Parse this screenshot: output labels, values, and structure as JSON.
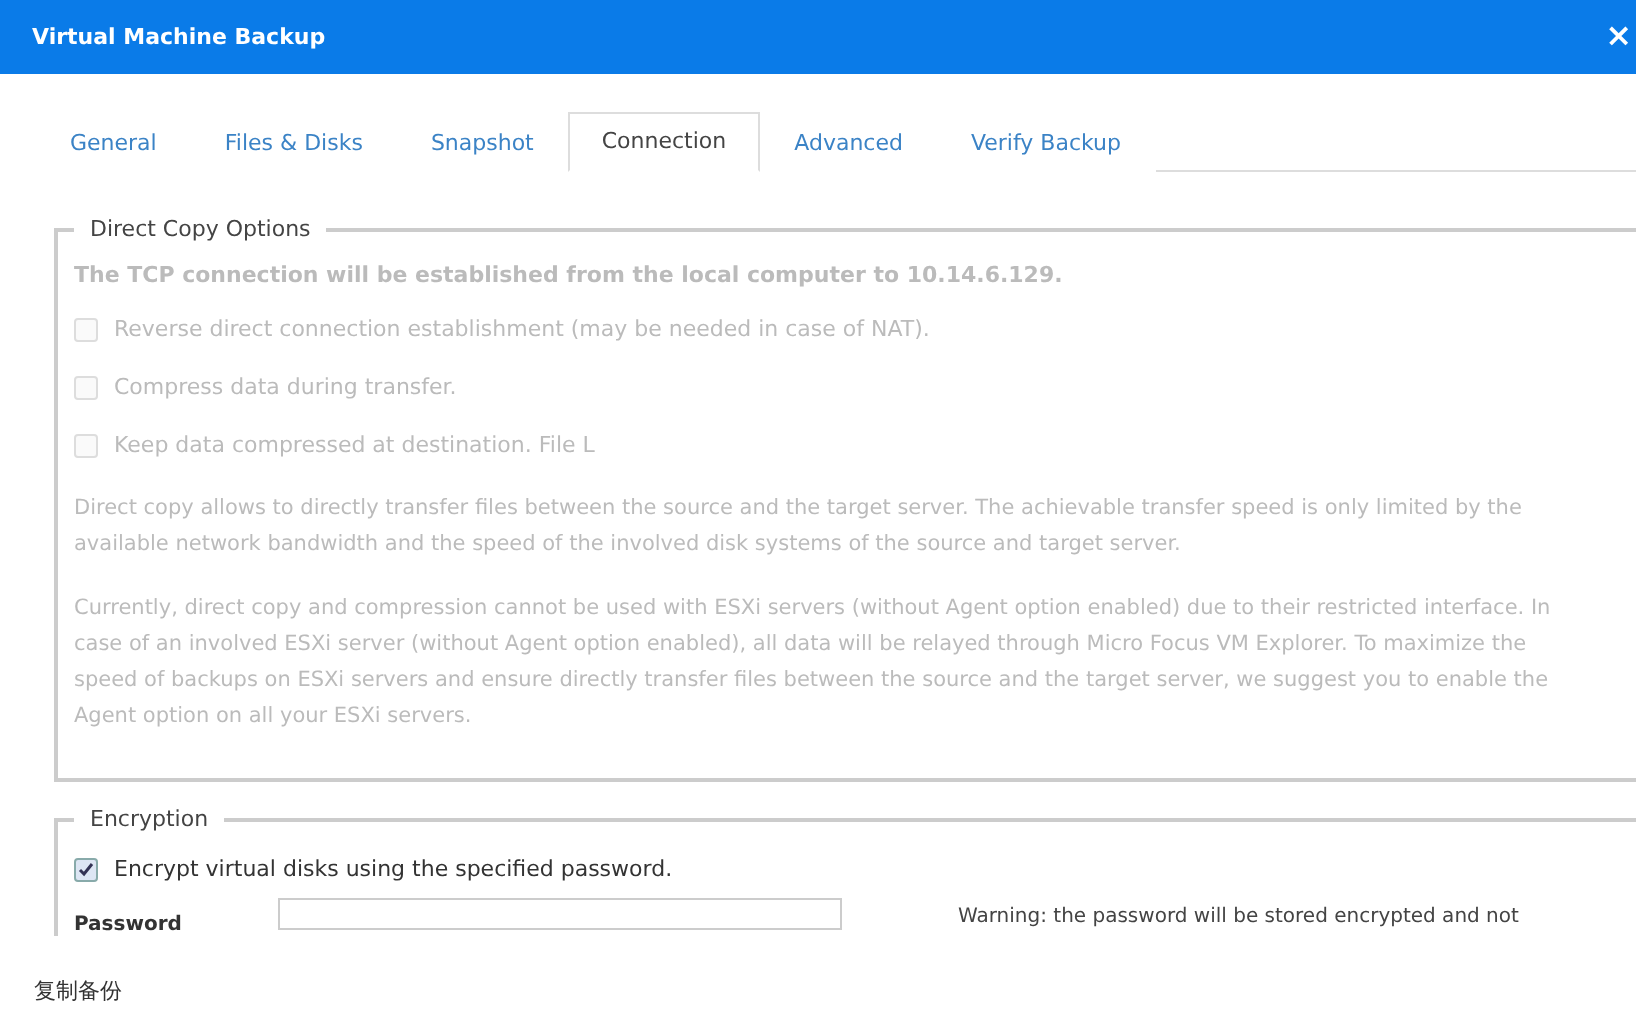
{
  "window": {
    "title": "Virtual Machine Backup",
    "close": "×"
  },
  "tabs": [
    {
      "label": "General",
      "selected": false
    },
    {
      "label": "Files & Disks",
      "selected": false
    },
    {
      "label": "Snapshot",
      "selected": false
    },
    {
      "label": "Connection",
      "selected": true
    },
    {
      "label": "Advanced",
      "selected": false
    },
    {
      "label": "Verify Backup",
      "selected": false
    }
  ],
  "direct_copy": {
    "legend": "Direct Copy Options",
    "disabled": true,
    "info": "The TCP connection will be established from the local computer to 10.14.6.129.",
    "options": [
      {
        "label": "Reverse direct connection establishment (may be needed in case of NAT).",
        "checked": false
      },
      {
        "label": "Compress data during transfer.",
        "checked": false
      },
      {
        "label": "Keep data compressed at destination. File L",
        "checked": false
      }
    ],
    "paragraphs": [
      "Direct copy allows to directly transfer files between the source and the target server. The achievable transfer speed is only limited by the available network bandwidth and the speed of the involved disk systems of the source and target server.",
      "Currently, direct copy and compression cannot be used with ESXi servers (without Agent option enabled) due to their restricted interface. In case of an involved ESXi server (without Agent option enabled), all data will be relayed through Micro Focus VM Explorer. To maximize the speed of backups on ESXi servers and ensure directly transfer files between the source and the target server, we suggest you to enable the Agent option on all your ESXi servers."
    ]
  },
  "encryption": {
    "legend": "Encryption",
    "option": {
      "label": "Encrypt virtual disks using the specified password.",
      "checked": true
    },
    "password_label": "Password",
    "warning": "Warning: the password will be stored encrypted and not"
  },
  "caption": "复制备份"
}
